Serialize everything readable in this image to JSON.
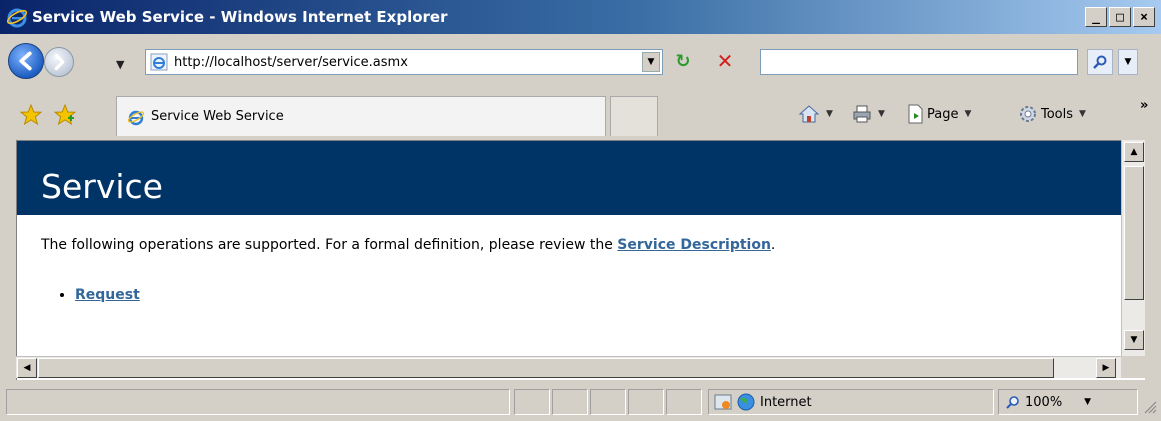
{
  "window": {
    "title": "Service Web Service - Windows Internet Explorer",
    "minimize_glyph": "_",
    "maximize_glyph": "□",
    "close_glyph": "×"
  },
  "address_bar": {
    "url": "http://localhost/server/service.asmx",
    "search_placeholder": ""
  },
  "tab": {
    "label": "Service Web Service"
  },
  "command_bar": {
    "page_label": "Page",
    "tools_label": "Tools",
    "overflow_glyph": "»"
  },
  "page": {
    "header_color": "#003366",
    "title": "Service",
    "intro_text": "The following operations are supported. For a formal definition, please review the ",
    "service_description_link": "Service Description",
    "intro_end": ".",
    "link_color": "#336699",
    "operations": [
      "Request"
    ]
  },
  "status_bar": {
    "zone_label": "Internet",
    "zoom_label": "100%"
  }
}
